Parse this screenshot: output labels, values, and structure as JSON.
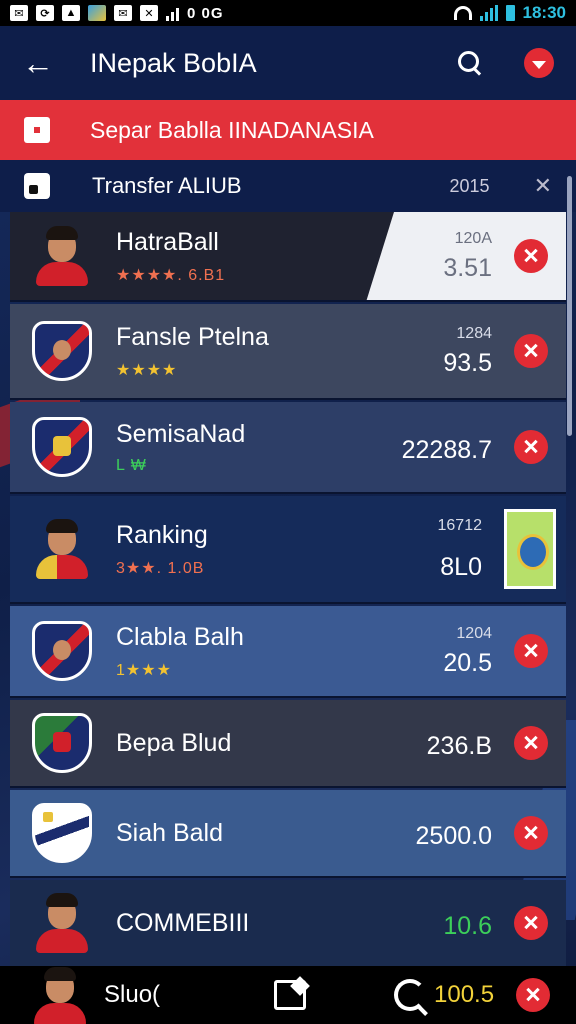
{
  "status_bar": {
    "left_icons": [
      "mail-icon",
      "sync-icon",
      "photo-icon",
      "app-icon",
      "email-icon",
      "missed-call-icon"
    ],
    "carrier_text": "0 0G",
    "time": "18:30"
  },
  "app_bar": {
    "title": "INepak BobIA"
  },
  "banner": {
    "text": "Separ Bablla IINADANASIA"
  },
  "section": {
    "title": "Transfer ALIUB",
    "count": "2015"
  },
  "rows": [
    {
      "name": "HatraBall",
      "sub": "★★★★. 6.B1",
      "small": "120A",
      "big": "3.51",
      "avatar": "player"
    },
    {
      "name": "Fansle Ptelna",
      "sub": "★★★★",
      "small": "1284",
      "big": "93.5",
      "avatar": "player"
    },
    {
      "name": "SemisaNad",
      "sub": "L ₩",
      "small": "",
      "big": "22288.7",
      "avatar": "badge"
    },
    {
      "name": "Ranking",
      "sub": "3★★. 1.0B",
      "small": "16712",
      "big": "8L0",
      "avatar": "player"
    },
    {
      "name": "Clabla Balh",
      "sub": "1★★★",
      "small": "1204",
      "big": "20.5",
      "avatar": "badge"
    },
    {
      "name": "Bepa Blud",
      "sub": "",
      "small": "",
      "big": "236.B",
      "avatar": "badge"
    },
    {
      "name": "Siah Bald",
      "sub": "",
      "small": "",
      "big": "2500.0",
      "avatar": "badge"
    },
    {
      "name": "COMMEBIII",
      "sub": "",
      "small": "",
      "big": "10.6",
      "avatar": "player"
    }
  ],
  "bottom_bar": {
    "label": "Sluo(",
    "value": "100.5"
  },
  "colors": {
    "accent_red": "#e2313a",
    "navy": "#0e1e4a",
    "star_yellow": "#f2c231",
    "positive_green": "#3ccf5a"
  }
}
